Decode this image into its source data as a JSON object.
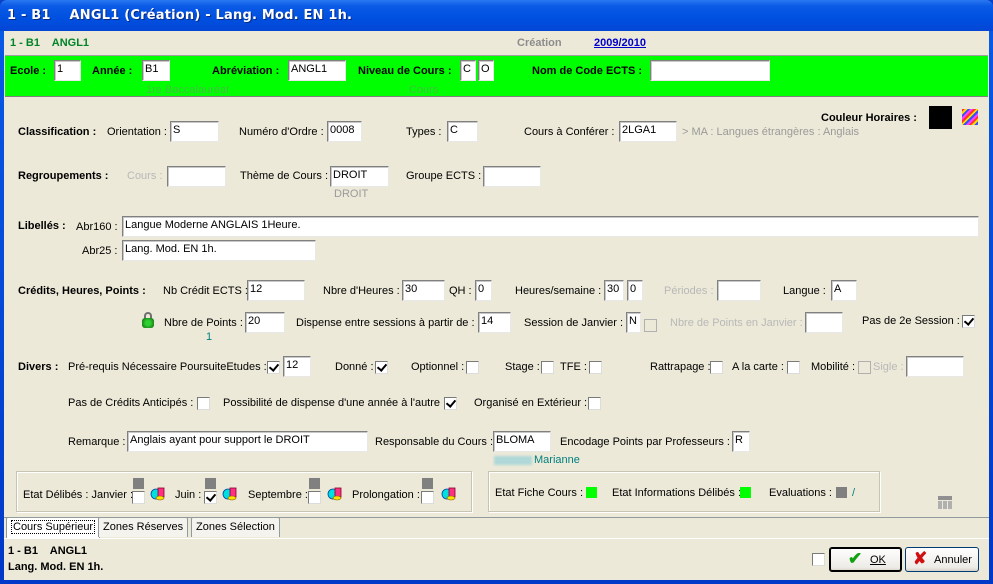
{
  "window": {
    "title": "1 - B1    ANGL1 (Création) - Lang. Mod. EN 1h."
  },
  "infobar": {
    "left": "1 - B1    ANGL1",
    "mode": "Création",
    "year": "2009/2010"
  },
  "header": {
    "ecole_label": "Ecole :",
    "ecole_value": "1",
    "annee_label": "Année :",
    "annee_value": "B1",
    "annee_desc": "1re Baccalauréat",
    "abrev_label": "Abréviation :",
    "abrev_value": "ANGL1",
    "niveau_label": "Niveau de Cours :",
    "niveau_value1": "C",
    "niveau_value2": "O",
    "niveau_desc": "Cours",
    "ects_label": "Nom de Code ECTS :",
    "ects_value": ""
  },
  "couleur": {
    "label": "Couleur Horaires :",
    "color": "#000000"
  },
  "classification": {
    "title": "Classification :",
    "orientation_label": "Orientation :",
    "orientation_value": "S",
    "ordre_label": "Numéro d'Ordre :",
    "ordre_value": "0008",
    "types_label": "Types :",
    "types_value": "C",
    "conferer_label": "Cours à Conférer :",
    "conferer_value": "2LGA1",
    "conferer_desc": "> MA : Langues étrangères : Anglais"
  },
  "regroupements": {
    "title": "Regroupements :",
    "cours_label": "Cours :",
    "cours_value": "",
    "theme_label": "Thème de Cours :",
    "theme_value": "DROIT",
    "theme_desc": "DROIT",
    "groupe_label": "Groupe ECTS :",
    "groupe_value": ""
  },
  "libelles": {
    "title": "Libellés :",
    "abr160_label": "Abr160 :",
    "abr160_value": "Langue Moderne ANGLAIS 1Heure.",
    "abr25_label": "Abr25 :",
    "abr25_value": "Lang. Mod. EN 1h."
  },
  "credits": {
    "title": "Crédits, Heures, Points :",
    "ects_label": "Nb Crédit ECTS :",
    "ects_value": "12",
    "heures_label": "Nbre d'Heures :",
    "heures_value": "30",
    "qh_label": "QH :",
    "qh_value": "0",
    "hsem_label": "Heures/semaine :",
    "hsem_value1": "30",
    "hsem_value2": "0",
    "periodes_label": "Périodes :",
    "periodes_value": "",
    "langue_label": "Langue :",
    "langue_value": "A",
    "points_label": "Nbre de Points :",
    "points_value": "20",
    "points_sub": "1",
    "dispense_label": "Dispense entre sessions à partir de :",
    "dispense_value": "14",
    "session_label": "Session de Janvier :",
    "session_value": "N",
    "points_janv_label": "Nbre de Points en Janvier :",
    "points_janv_value": "",
    "pas2e_label": "Pas de 2e Session :",
    "pas2e_checked": true
  },
  "divers": {
    "title": "Divers :",
    "prereq_label": "Pré-requis Nécessaire PoursuiteEtudes :",
    "prereq_checked": true,
    "prereq_value": "12",
    "donne_label": "Donné :",
    "donne_checked": true,
    "optionnel_label": "Optionnel :",
    "stage_label": "Stage :",
    "tfe_label": "TFE :",
    "rattrapage_label": "Rattrapage :",
    "carte_label": "A la carte :",
    "mobilite_label": "Mobilité :",
    "sigle_label": "Sigle :",
    "sigle_value": "",
    "anticipes_label": "Pas de Crédits Anticipés :",
    "dispense_annee_label": "Possibilité de dispense d'une année à l'autre :",
    "dispense_annee_checked": true,
    "exterieur_label": "Organisé en Extérieur :",
    "remarque_label": "Remarque :",
    "remarque_value": "Anglais ayant pour support le DROIT",
    "responsable_label": "Responsable du Cours :",
    "responsable_value": "BLOMA",
    "responsable_name": "Marianne",
    "encodage_label": "Encodage Points par Professeurs :",
    "encodage_value": "R"
  },
  "etat_delibes": {
    "label": "Etat Délibés : Janvier :",
    "juin_label": "Juin :",
    "juin_checked": true,
    "septembre_label": "Septembre :",
    "prolongation_label": "Prolongation :"
  },
  "etat_fiche": {
    "fiche_label": "Etat Fiche Cours :",
    "fiche_color": "#00ff00",
    "infos_label": "Etat Informations Délibés :",
    "infos_color": "#00ff00",
    "evaluations_label": "Evaluations :",
    "evaluations_color": "#808080",
    "evaluations_value": "/"
  },
  "tabs": [
    {
      "label": "Cours Supérieur"
    },
    {
      "label": "Zones Réserves"
    },
    {
      "label": "Zones Sélection"
    }
  ],
  "footer": {
    "line1": "1 - B1    ANGL1",
    "line2": "Lang. Mod. EN 1h.",
    "ok_label": "OK",
    "cancel_label": "Annuler"
  }
}
